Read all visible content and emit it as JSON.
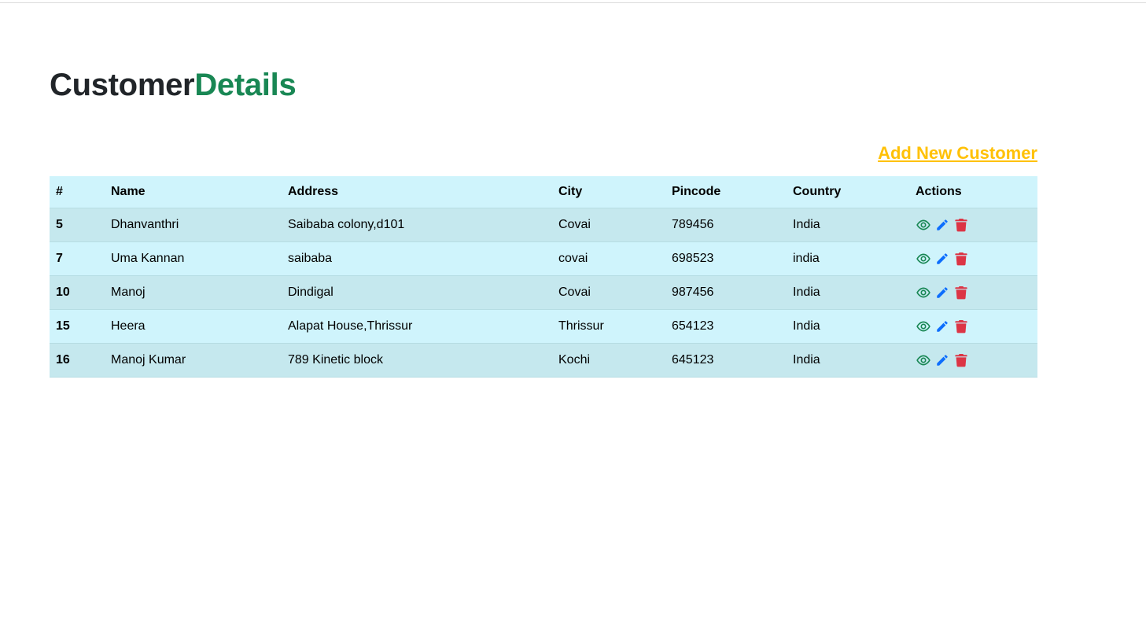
{
  "header": {
    "title_part1": "Customer",
    "title_part2": "Details",
    "add_link_label": "Add New Customer"
  },
  "table": {
    "columns": [
      "#",
      "Name",
      "Address",
      "City",
      "Pincode",
      "Country",
      "Actions"
    ],
    "rows": [
      {
        "id": "5",
        "name": "Dhanvanthri",
        "address": "Saibaba colony,d101",
        "city": "Covai",
        "pincode": "789456",
        "country": "India"
      },
      {
        "id": "7",
        "name": "Uma Kannan",
        "address": "saibaba",
        "city": "covai",
        "pincode": "698523",
        "country": "india"
      },
      {
        "id": "10",
        "name": "Manoj",
        "address": "Dindigal",
        "city": "Covai",
        "pincode": "987456",
        "country": "India"
      },
      {
        "id": "15",
        "name": "Heera",
        "address": "Alapat House,Thrissur",
        "city": "Thrissur",
        "pincode": "654123",
        "country": "India"
      },
      {
        "id": "16",
        "name": "Manoj Kumar",
        "address": "789 Kinetic block",
        "city": "Kochi",
        "pincode": "645123",
        "country": "India"
      }
    ],
    "row_actions": [
      {
        "icon": "eye-icon",
        "action": "view",
        "color": "#198754"
      },
      {
        "icon": "pencil-icon",
        "action": "edit",
        "color": "#0d6efd"
      },
      {
        "icon": "trash-icon",
        "action": "delete",
        "color": "#dc3545"
      }
    ]
  },
  "colors": {
    "accent_green": "#198754",
    "link_yellow": "#ffc107",
    "table_bg": "#cff4fc",
    "table_stripe": "#c5e8ee"
  }
}
